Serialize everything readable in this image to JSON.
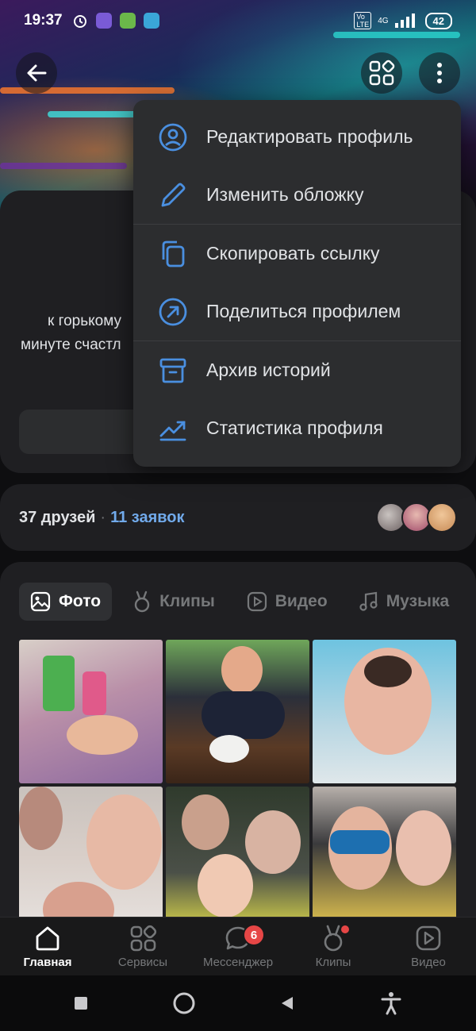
{
  "status_bar": {
    "time": "19:37",
    "network": "4G",
    "battery": "42"
  },
  "profile": {
    "status_line1": "к горькому",
    "status_line2": "минуте счастл"
  },
  "menu": {
    "items": [
      {
        "label": "Редактировать профиль",
        "icon": "user-circle-icon"
      },
      {
        "label": "Изменить обложку",
        "icon": "pencil-icon"
      },
      {
        "label": "Скопировать ссылку",
        "icon": "copy-icon"
      },
      {
        "label": "Поделиться профилем",
        "icon": "share-arrow-icon"
      },
      {
        "label": "Архив историй",
        "icon": "archive-icon"
      },
      {
        "label": "Статистика профиля",
        "icon": "stats-icon"
      }
    ]
  },
  "friends": {
    "count": "37 друзей",
    "separator": "·",
    "requests": "11 заявок"
  },
  "media_tabs": [
    {
      "label": "Фото",
      "icon": "photo-icon",
      "active": true
    },
    {
      "label": "Клипы",
      "icon": "clips-icon"
    },
    {
      "label": "Видео",
      "icon": "video-icon"
    },
    {
      "label": "Музыка",
      "icon": "music-icon"
    }
  ],
  "bottom_nav": {
    "items": [
      {
        "label": "Главная",
        "icon": "home-icon",
        "active": true
      },
      {
        "label": "Сервисы",
        "icon": "services-icon"
      },
      {
        "label": "Мессенджер",
        "icon": "messenger-icon",
        "badge": "6"
      },
      {
        "label": "Клипы",
        "icon": "clips-icon",
        "dot": true
      },
      {
        "label": "Видео",
        "icon": "video-icon"
      }
    ]
  },
  "colors": {
    "accent": "#71aaeb",
    "menu_icon": "#4a8fe0",
    "badge": "#e64646",
    "card": "#1f1f22"
  }
}
